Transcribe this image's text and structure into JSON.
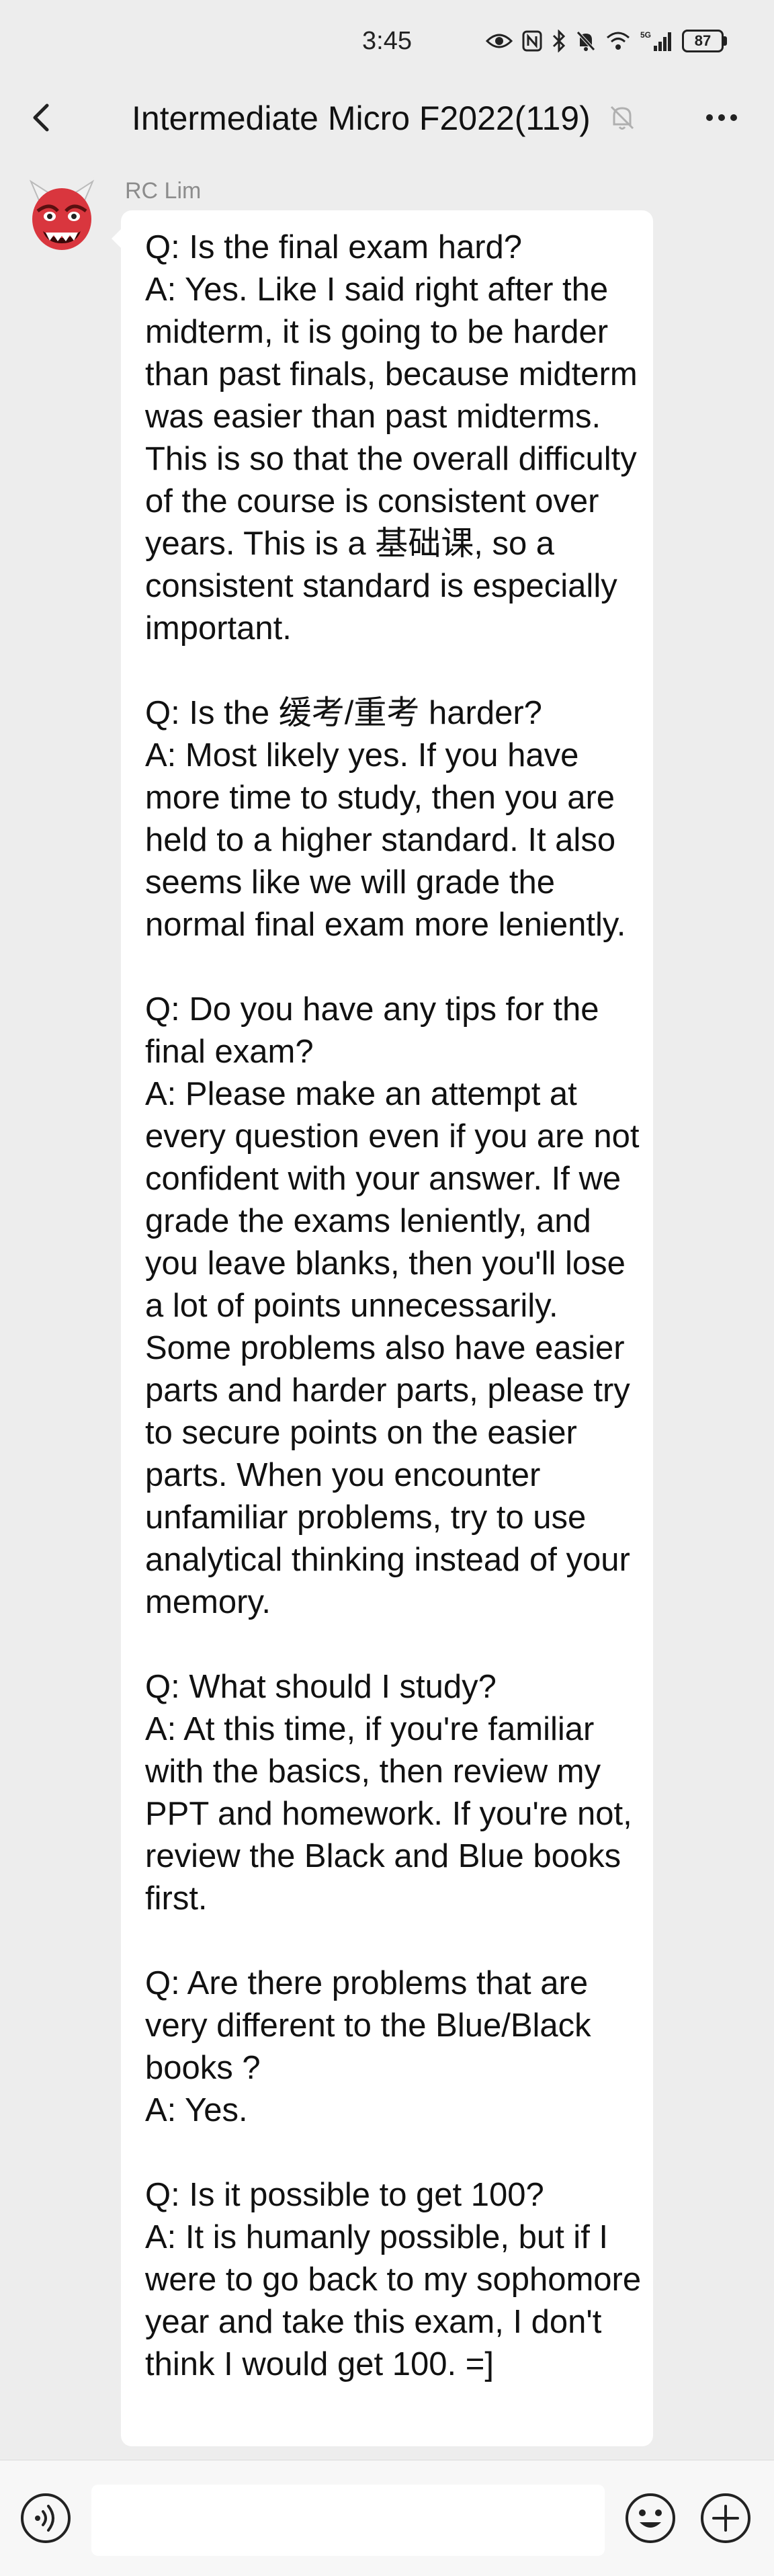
{
  "status_bar": {
    "time": "3:45",
    "battery": "87",
    "network": "5G"
  },
  "nav": {
    "title": "Intermediate Micro F2022(119)",
    "back_icon": "chevron-left-icon",
    "mute_icon": "bell-muted-icon",
    "more_icon": "more-dots-icon"
  },
  "message": {
    "sender": "RC Lim",
    "avatar_icon": "red-ogre-emoji",
    "qa": [
      {
        "q": "Q: Is the final exam hard?",
        "a": "A: Yes. Like I said right after the midterm, it is going to be harder than past finals, because midterm was easier than past midterms. This is so that the overall difficulty of the course is consistent over years. This is a 基础课, so a consistent standard is especially important."
      },
      {
        "q": "Q: Is the 缓考/重考 harder?",
        "a": "A: Most likely yes. If you have more time to study, then you are held to a higher standard. It also seems like we will grade the normal final exam more leniently."
      },
      {
        "q": "Q: Do you have any tips for the final exam?",
        "a": "A: Please make an attempt at every question even if you are not confident with your answer. If we grade the exams leniently, and you leave blanks, then you'll lose a lot of points unnecessarily. Some problems also have easier parts and harder parts, please try to secure points on the easier parts. When you encounter unfamiliar problems, try to use analytical thinking instead of your memory."
      },
      {
        "q": "Q: What should I study?",
        "a": "A: At this time, if you're familiar with the basics, then review my PPT and homework. If you're not, review the Black and Blue books first."
      },
      {
        "q": "Q: Are there problems that are very different to the Blue/Black books ?",
        "a": "A: Yes."
      },
      {
        "q": "Q: Is it possible to get 100?",
        "a": "A: It is humanly possible, but if I were to go back to my sophomore year and take this exam, I don't think I would get 100. =]"
      }
    ]
  },
  "input_bar": {
    "placeholder": "",
    "voice_icon": "voice-icon",
    "emoji_icon": "emoji-icon",
    "add_icon": "plus-icon"
  },
  "colors": {
    "background": "#ededed",
    "bubble": "#ffffff",
    "sender_name": "#8c8c8c",
    "avatar_red": "#d9363e"
  }
}
